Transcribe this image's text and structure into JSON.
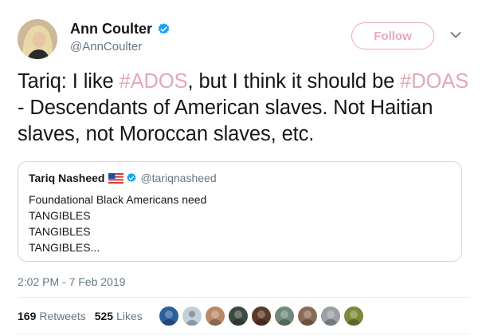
{
  "author": {
    "display_name": "Ann Coulter",
    "handle": "@AnnCoulter",
    "verified": true,
    "avatar_icon": "profile-photo"
  },
  "follow_button": {
    "label": "Follow"
  },
  "menu_icon": "chevron-down-icon",
  "tweet": {
    "segments": [
      {
        "text": "Tariq: I like ",
        "type": "text"
      },
      {
        "text": "#ADOS",
        "type": "hashtag"
      },
      {
        "text": ", but I think it should be ",
        "type": "text"
      },
      {
        "text": "#DOAS",
        "type": "hashtag"
      },
      {
        "text": " - Descendants of American slaves. Not Haitian slaves, not Moroccan slaves, etc.",
        "type": "text"
      }
    ]
  },
  "quoted_tweet": {
    "display_name": "Tariq Nasheed",
    "flag_icon": "us-flag-emoji",
    "verified": true,
    "handle": "@tariqnasheed",
    "lines": [
      "Foundational Black Americans need",
      "TANGIBLES",
      "TANGIBLES",
      "TANGIBLES..."
    ]
  },
  "timestamp": "2:02 PM - 7 Feb 2019",
  "stats": {
    "retweets_count": "169",
    "retweets_label": "Retweets",
    "likes_count": "525",
    "likes_label": "Likes"
  },
  "likers": [
    {
      "icon": "liker-avatar-1",
      "color": "#2d5f9a"
    },
    {
      "icon": "liker-avatar-2-default",
      "color": "#c4cfd6"
    },
    {
      "icon": "liker-avatar-3",
      "color": "#b98a6a"
    },
    {
      "icon": "liker-avatar-4",
      "color": "#3c4a40"
    },
    {
      "icon": "liker-avatar-5",
      "color": "#5b3a2a"
    },
    {
      "icon": "liker-avatar-6",
      "color": "#6f8a7a"
    },
    {
      "icon": "liker-avatar-7",
      "color": "#8c6b55"
    },
    {
      "icon": "liker-avatar-8",
      "color": "#9aa0a6"
    },
    {
      "icon": "liker-avatar-9",
      "color": "#7a8a3a"
    }
  ],
  "colors": {
    "hashtag": "#e2a9b3",
    "follow_border": "#e8a9b6",
    "secondary_text": "#657786",
    "verified_blue": "#1da1f2"
  }
}
